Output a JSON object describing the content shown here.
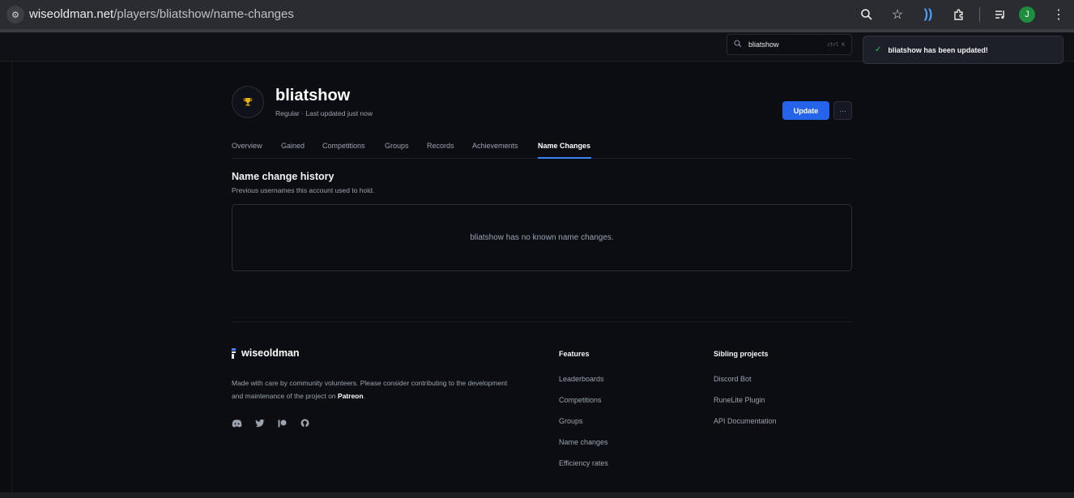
{
  "browser": {
    "url_host": "wiseoldman.net",
    "url_path": "/players/bliatshow/name-changes",
    "profile_initial": "J"
  },
  "header": {
    "search_value": "bliatshow",
    "search_shortcut": "ctrl K"
  },
  "toast": {
    "message": "bliatshow has been updated!"
  },
  "player": {
    "name": "bliatshow",
    "subtitle": "Regular · Last updated just now",
    "update_label": "Update",
    "more_label": "···"
  },
  "tabs": [
    {
      "label": "Overview"
    },
    {
      "label": "Gained"
    },
    {
      "label": "Competitions"
    },
    {
      "label": "Groups"
    },
    {
      "label": "Records"
    },
    {
      "label": "Achievements"
    },
    {
      "label": "Name Changes"
    }
  ],
  "main": {
    "title": "Name change history",
    "subtitle": "Previous usernames this account used to hold.",
    "empty_message": "bliatshow has no known name changes."
  },
  "footer": {
    "brand": "wiseoldman",
    "description": "Made with care by community volunteers. Please consider contributing to the development and maintenance of the project on ",
    "description_link": "Patreon",
    "description_end": ".",
    "features_title": "Features",
    "features": [
      "Leaderboards",
      "Competitions",
      "Groups",
      "Name changes",
      "Efficiency rates"
    ],
    "siblings_title": "Sibling projects",
    "siblings": [
      "Discord Bot",
      "RuneLite Plugin",
      "API Documentation"
    ]
  },
  "colors": {
    "accent": "#2563eb",
    "tab_active_underline": "#3b82f6",
    "success": "#22c55e",
    "background": "#0b0d12"
  }
}
